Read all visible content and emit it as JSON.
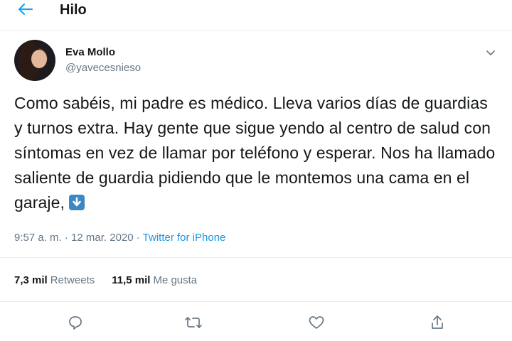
{
  "header": {
    "title": "Hilo",
    "back_icon": "arrow-left-icon"
  },
  "author": {
    "display_name": "Eva Mollo",
    "username": "@yavecesnieso"
  },
  "tweet": {
    "text": "Como sabéis, mi padre es médico. Lleva varios días de guardias y turnos extra. Hay gente que sigue yendo al centro de salud con síntomas en vez de llamar por teléfono y esperar. Nos ha llamado saliente de guardia pidiendo que le montemos una cama en el garaje,",
    "emoji": "down-arrow-emoji"
  },
  "meta": {
    "time": "9:57 a. m.",
    "separator": " · ",
    "date": "12 mar. 2020",
    "source_sep": " · ",
    "source": "Twitter for iPhone"
  },
  "stats": {
    "retweets_count": "7,3 mil",
    "retweets_label": "Retweets",
    "likes_count": "11,5 mil",
    "likes_label": "Me gusta"
  },
  "actions": [
    "reply-icon",
    "retweet-icon",
    "like-icon",
    "share-icon"
  ],
  "colors": {
    "accent": "#1da1f2",
    "link": "#1b95e0",
    "muted": "#657786",
    "text": "#14171a",
    "border": "#e6ecf0"
  }
}
